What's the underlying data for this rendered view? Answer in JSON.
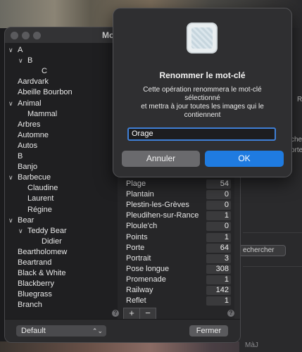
{
  "window": {
    "title": "Mo"
  },
  "tree": [
    {
      "label": "A",
      "level": 0,
      "expanded": true
    },
    {
      "label": "B",
      "level": 1,
      "expanded": true
    },
    {
      "label": "C",
      "level": 2,
      "expanded": null
    },
    {
      "label": "Aardvark",
      "level": 0,
      "expanded": null
    },
    {
      "label": "Abeille Bourbon",
      "level": 0,
      "expanded": null
    },
    {
      "label": "Animal",
      "level": 0,
      "expanded": true
    },
    {
      "label": "Mammal",
      "level": 1,
      "expanded": null
    },
    {
      "label": "Arbres",
      "level": 0,
      "expanded": null
    },
    {
      "label": "Automne",
      "level": 0,
      "expanded": null
    },
    {
      "label": "Autos",
      "level": 0,
      "expanded": null
    },
    {
      "label": "B",
      "level": 0,
      "expanded": null
    },
    {
      "label": "Banjo",
      "level": 0,
      "expanded": null
    },
    {
      "label": "Barbecue",
      "level": 0,
      "expanded": true
    },
    {
      "label": "Claudine",
      "level": 1,
      "expanded": null
    },
    {
      "label": "Laurent",
      "level": 1,
      "expanded": null
    },
    {
      "label": "Régine",
      "level": 1,
      "expanded": null
    },
    {
      "label": "Bear",
      "level": 0,
      "expanded": true
    },
    {
      "label": "Teddy Bear",
      "level": 1,
      "expanded": true
    },
    {
      "label": "Didier",
      "level": 2,
      "expanded": null
    },
    {
      "label": "Beartholomew",
      "level": 0,
      "expanded": null
    },
    {
      "label": "Beartrand",
      "level": 0,
      "expanded": null
    },
    {
      "label": "Black & White",
      "level": 0,
      "expanded": null
    },
    {
      "label": "Blackberry",
      "level": 0,
      "expanded": null
    },
    {
      "label": "Bluegrass",
      "level": 0,
      "expanded": null
    },
    {
      "label": "Branch",
      "level": 0,
      "expanded": null
    }
  ],
  "keywords": [
    {
      "name": "Plage",
      "count": "54"
    },
    {
      "name": "Plantain",
      "count": "0"
    },
    {
      "name": "Plestin-les-Grèves",
      "count": "0"
    },
    {
      "name": "Pleudihen-sur-Rance",
      "count": "1"
    },
    {
      "name": "Ploule'ch",
      "count": "0"
    },
    {
      "name": "Points",
      "count": "1"
    },
    {
      "name": "Porte",
      "count": "64"
    },
    {
      "name": "Portrait",
      "count": "3"
    },
    {
      "name": "Pose longue",
      "count": "308"
    },
    {
      "name": "Promenade",
      "count": "1"
    },
    {
      "name": "Railway",
      "count": "142"
    },
    {
      "name": "Reflet",
      "count": "1"
    }
  ],
  "footer": {
    "keyword_set": "Default",
    "close_label": "Fermer",
    "add_label": "+",
    "remove_label": "−",
    "help": "?"
  },
  "dialog": {
    "title": "Renommer le mot-clé",
    "message_lines": [
      "Cette opération renommera le mot-clé",
      "sélectionné",
      "et mettra à jour toutes les images qui le",
      "contiennent"
    ],
    "input_value": "Orage",
    "cancel_label": "Annuler",
    "ok_label": "OK"
  },
  "background_window": {
    "search_label": "echercher",
    "side_letter": "R",
    "fragment1": "cher",
    "fragment2": "orte",
    "fragment3": "MàJ"
  },
  "colors": {
    "accent": "#1f7be0",
    "focus_ring": "#3f7fd6"
  }
}
